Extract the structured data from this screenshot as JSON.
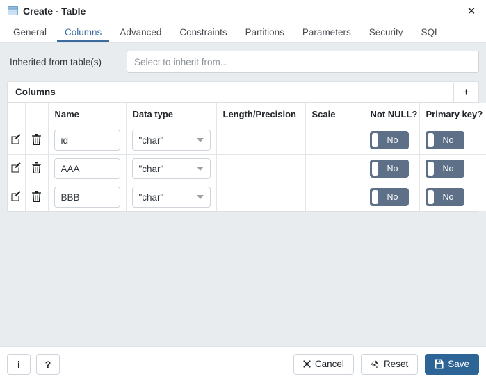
{
  "window": {
    "title": "Create - Table",
    "title_icon": "table-icon",
    "close_icon": "close-icon"
  },
  "tabs": [
    {
      "label": "General",
      "active": false
    },
    {
      "label": "Columns",
      "active": true
    },
    {
      "label": "Advanced",
      "active": false
    },
    {
      "label": "Constraints",
      "active": false
    },
    {
      "label": "Partitions",
      "active": false
    },
    {
      "label": "Parameters",
      "active": false
    },
    {
      "label": "Security",
      "active": false
    },
    {
      "label": "SQL",
      "active": false
    }
  ],
  "inherited": {
    "label": "Inherited from table(s)",
    "placeholder": "Select to inherit from...",
    "value": ""
  },
  "columns_panel": {
    "title": "Columns",
    "add_icon": "plus-icon",
    "headers": [
      "",
      "",
      "Name",
      "Data type",
      "Length/Precision",
      "Scale",
      "Not NULL?",
      "Primary key?"
    ],
    "rows": [
      {
        "edit_icon": "edit-icon",
        "delete_icon": "trash-icon",
        "name": "id",
        "data_type": "\"char\"",
        "length_precision": "",
        "scale": "",
        "not_null": "No",
        "primary_key": "No"
      },
      {
        "edit_icon": "edit-icon",
        "delete_icon": "trash-icon",
        "name": "AAA",
        "data_type": "\"char\"",
        "length_precision": "",
        "scale": "",
        "not_null": "No",
        "primary_key": "No"
      },
      {
        "edit_icon": "edit-icon",
        "delete_icon": "trash-icon",
        "name": "BBB",
        "data_type": "\"char\"",
        "length_precision": "",
        "scale": "",
        "not_null": "No",
        "primary_key": "No"
      }
    ]
  },
  "footer": {
    "info_label": "i",
    "help_label": "?",
    "cancel_label": "Cancel",
    "cancel_icon": "close-icon",
    "reset_label": "Reset",
    "reset_icon": "recycle-icon",
    "save_label": "Save",
    "save_icon": "save-disk-icon"
  },
  "colors": {
    "accent": "#3c6c9e",
    "primary_button": "#2c6496",
    "toggle_off": "#5d7088",
    "background": "#e9ecef",
    "panel": "#ffffff"
  }
}
